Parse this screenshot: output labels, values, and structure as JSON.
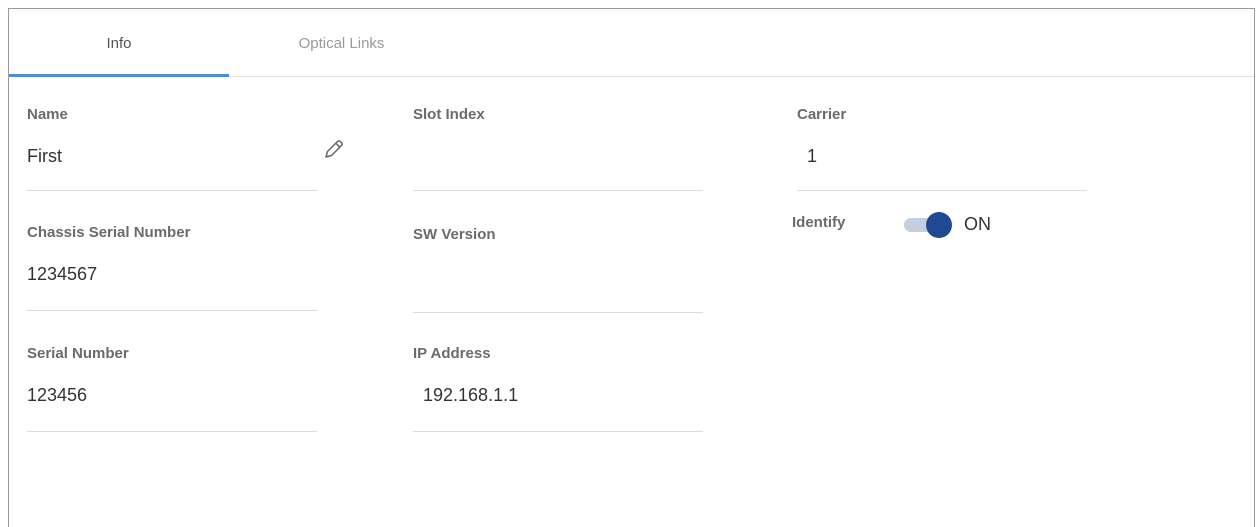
{
  "tabs": [
    {
      "label": "Info",
      "active": true
    },
    {
      "label": "Optical Links",
      "active": false
    }
  ],
  "fields": {
    "name": {
      "label": "Name",
      "value": "First"
    },
    "slot_index": {
      "label": "Slot Index",
      "value": ""
    },
    "carrier": {
      "label": "Carrier",
      "value": "1"
    },
    "chassis_serial": {
      "label": "Chassis Serial Number",
      "value": "1234567"
    },
    "sw_version": {
      "label": "SW Version",
      "value": ""
    },
    "serial_number": {
      "label": "Serial Number",
      "value": "123456"
    },
    "ip_address": {
      "label": "IP Address",
      "value": "192.168.1.1"
    }
  },
  "identify": {
    "label": "Identify",
    "state": "ON",
    "enabled": true
  },
  "icons": {
    "edit": "pencil-icon"
  },
  "colors": {
    "accent": "#4a90d9",
    "toggle_knob": "#1f4a93",
    "toggle_track": "#c5cde0"
  }
}
